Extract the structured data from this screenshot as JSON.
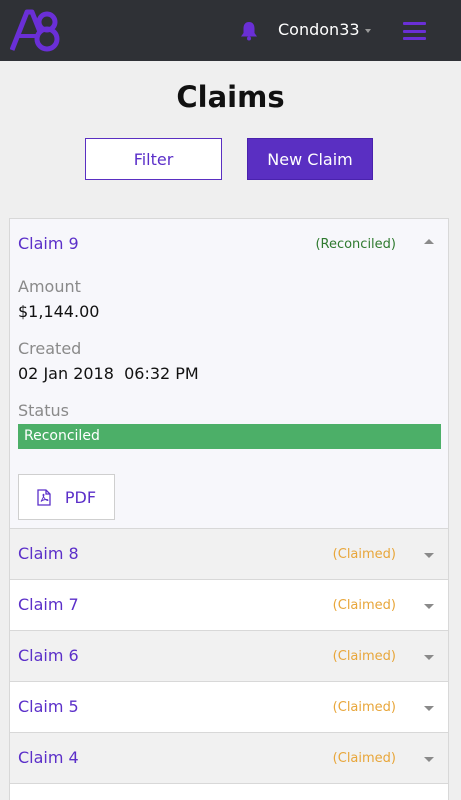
{
  "header": {
    "logo_icon": "a8-logo-icon",
    "notification_icon": "bell-icon",
    "username": "Condon33",
    "menu_icon": "hamburger-menu-icon",
    "accent_color": "#6a2fd6"
  },
  "page": {
    "title": "Claims",
    "filter_label": "Filter",
    "new_claim_label": "New Claim"
  },
  "claims": {
    "open": {
      "title": "Claim 9",
      "state": "(Reconciled)",
      "amount_label": "Amount",
      "amount_value": "$1,144.00",
      "created_label": "Created",
      "created_value": "02 Jan 2018  06:32 PM",
      "status_label": "Status",
      "status_value": "Reconciled",
      "status_color": "#4caf68",
      "pdf_label": "PDF",
      "pdf_icon": "pdf-file-icon"
    },
    "rows": [
      {
        "title": "Claim 8",
        "state": "(Claimed)"
      },
      {
        "title": "Claim 7",
        "state": "(Claimed)"
      },
      {
        "title": "Claim 6",
        "state": "(Claimed)"
      },
      {
        "title": "Claim 5",
        "state": "(Claimed)"
      },
      {
        "title": "Claim 4",
        "state": "(Claimed)"
      }
    ]
  }
}
